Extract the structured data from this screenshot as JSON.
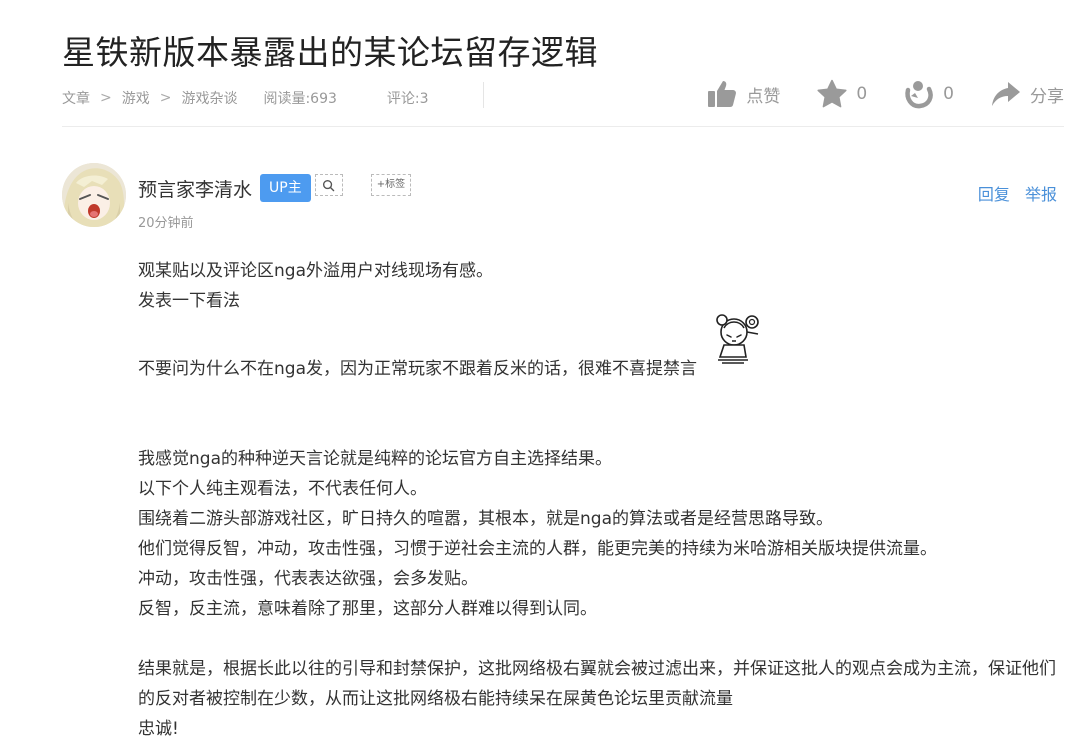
{
  "post": {
    "title": "星铁新版本暴露出的某论坛留存逻辑",
    "breadcrumb": [
      "文章",
      "游戏",
      "游戏杂谈"
    ],
    "breadcrumb_sep": ">",
    "reads": "阅读量:693",
    "comments": "评论:3"
  },
  "actions": {
    "like_label": "点赞",
    "favorite_count": "0",
    "hug_count": "0",
    "share_label": "分享"
  },
  "author": {
    "name": "预言家李清水",
    "badge": "UP主",
    "tag_label": "+标签",
    "time": "20分钟前"
  },
  "reply": {
    "reply_label": "回复",
    "report_label": "举报"
  },
  "body": {
    "p1": "观某贴以及评论区nga外溢用户对线现场有感。",
    "p2": "发表一下看法",
    "p3": "不要问为什么不在nga发，因为正常玩家不跟着反米的话，很难不喜提禁言",
    "p4": "我感觉nga的种种逆天言论就是纯粹的论坛官方自主选择结果。",
    "p5": "以下个人纯主观看法，不代表任何人。",
    "p6": "围绕着二游头部游戏社区，旷日持久的喧嚣，其根本，就是nga的算法或者是经营思路导致。",
    "p7": "他们觉得反智，冲动，攻击性强，习惯于逆社会主流的人群，能更完美的持续为米哈游相关版块提供流量。",
    "p8": "冲动，攻击性强，代表表达欲强，会多发贴。",
    "p9": "反智，反主流，意味着除了那里，这部分人群难以得到认同。",
    "p10": "结果就是，根据长此以往的引导和封禁保护，这批网络极右翼就会被过滤出来，并保证这批人的观点会成为主流，保证他们的反对者被控制在少数，从而让这批网络极右能持续呆在屎黄色论坛里贡献流量",
    "p11": "忠诚!"
  },
  "colors": {
    "accent": "#4d9bf0",
    "link": "#4a90d9",
    "muted": "#999999"
  },
  "icons": [
    "thumbs-up-icon",
    "star-icon",
    "hug-icon",
    "share-arrow-icon",
    "search-icon"
  ]
}
